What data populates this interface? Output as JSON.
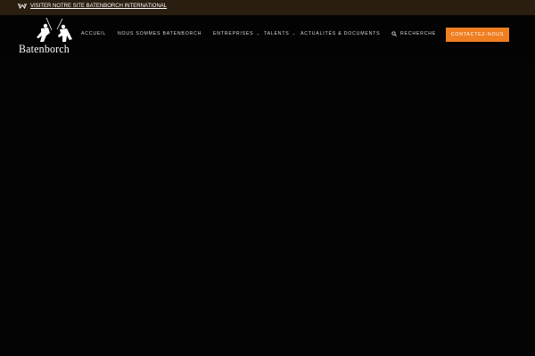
{
  "topbar": {
    "link_label": "Visiter notre site Batenborch International",
    "icon": "w-logo-icon"
  },
  "header": {
    "logo_text": "Batenborch",
    "logo_icon": "samurai-logo-icon",
    "nav": [
      {
        "label": "Accueil",
        "has_dropdown": false
      },
      {
        "label": "Nous sommes Batenborch",
        "has_dropdown": false
      },
      {
        "label": "Entreprises",
        "has_dropdown": true
      },
      {
        "label": "Talents",
        "has_dropdown": true
      },
      {
        "label": "Actualités & Documents",
        "has_dropdown": false
      },
      {
        "label": "Recherche",
        "has_dropdown": false,
        "icon": "search-icon"
      }
    ],
    "cta_label": "Contactez-nous"
  },
  "colors": {
    "topbar_bg": "#2a1e10",
    "page_bg": "#050505",
    "accent": "#f07f22",
    "nav_text": "#d8d8d8"
  }
}
